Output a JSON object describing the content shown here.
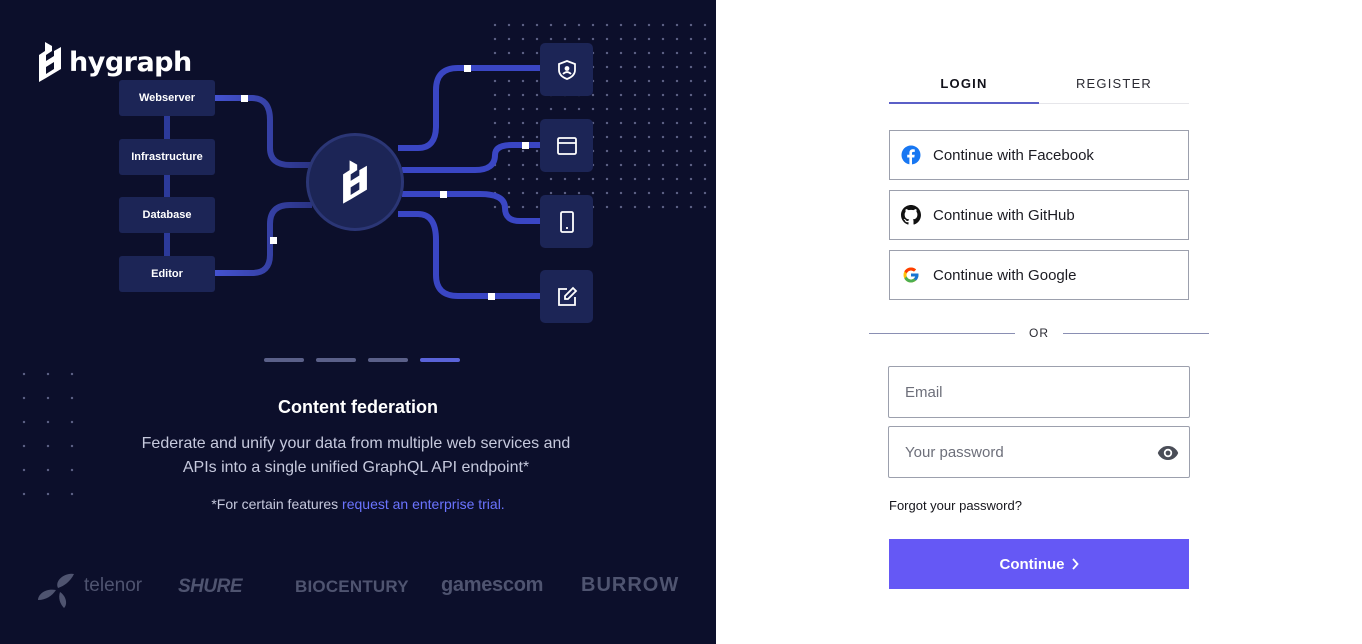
{
  "brand": {
    "name": "hygraph"
  },
  "diagram": {
    "sources": [
      "Webserver",
      "Infrastructure",
      "Database",
      "Editor"
    ],
    "targets": [
      "shield-user-icon",
      "browser-window-icon",
      "mobile-device-icon",
      "edit-icon"
    ]
  },
  "carousel": {
    "total": 4,
    "active_index": 3
  },
  "feature": {
    "title": "Content federation",
    "description": "Federate and unify your data from multiple web services and APIs into a single unified GraphQL API endpoint*",
    "note_prefix": "*For certain features ",
    "note_link": "request an enterprise trial."
  },
  "brands": [
    "telenor",
    "SHURE",
    "BIOCENTURY",
    "gamescom",
    "BURROW"
  ],
  "auth": {
    "tabs": [
      {
        "label": "LOGIN",
        "active": true
      },
      {
        "label": "REGISTER",
        "active": false
      }
    ],
    "social": [
      {
        "label": "Continue with Facebook",
        "icon": "facebook-icon"
      },
      {
        "label": "Continue with GitHub",
        "icon": "github-icon"
      },
      {
        "label": "Continue with Google",
        "icon": "google-icon"
      }
    ],
    "divider": "OR",
    "email": {
      "placeholder": "Email",
      "value": ""
    },
    "password": {
      "placeholder": "Your password",
      "value": ""
    },
    "forgot": "Forgot your password?",
    "submit": "Continue"
  },
  "colors": {
    "panel_bg": "#0c0f2b",
    "accent": "#6558f5",
    "node": "#1c2556",
    "flow": "#4c57d6"
  }
}
